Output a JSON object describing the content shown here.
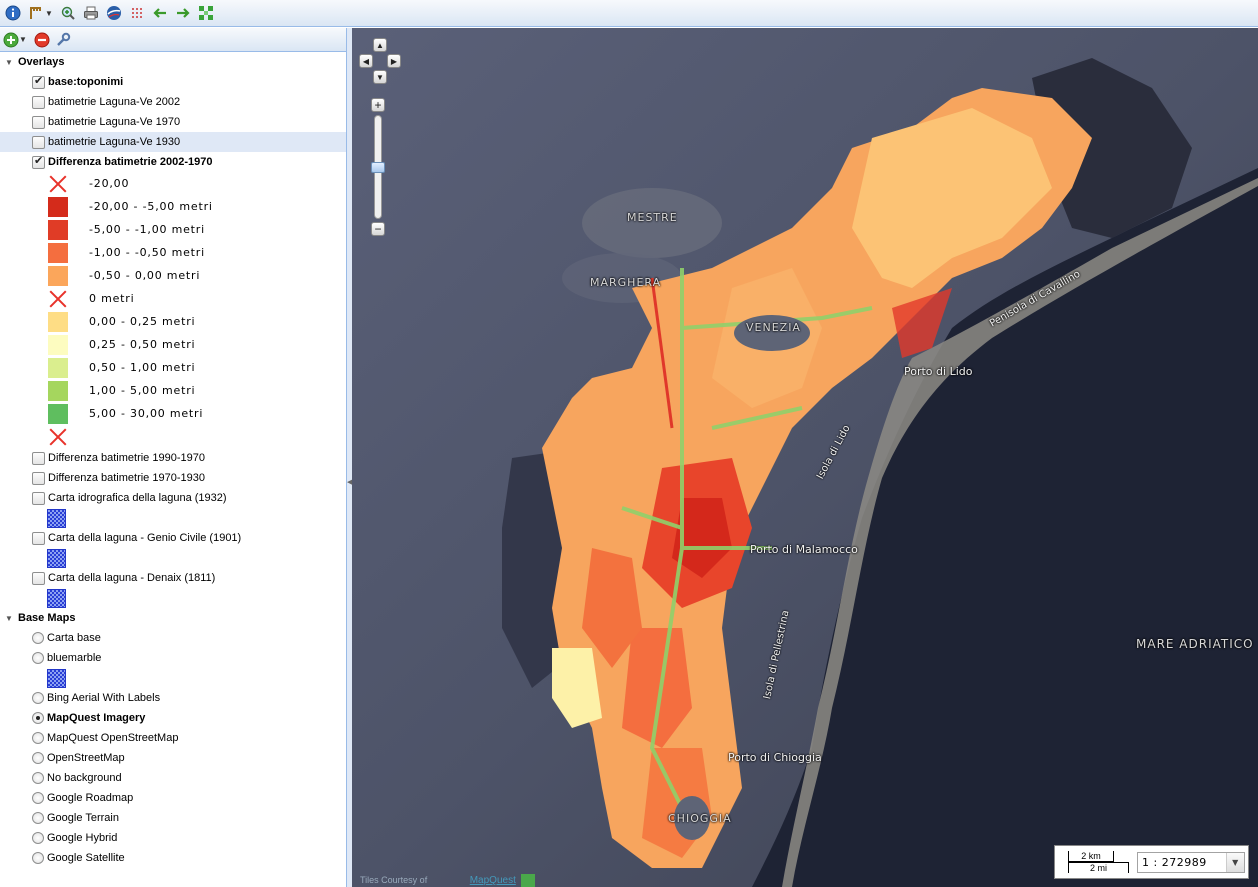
{
  "toolbar": {
    "buttons": [
      "info-icon",
      "measure-icon",
      "zoom-in-icon",
      "print-icon",
      "google-earth-icon",
      "measure-clear-icon",
      "back-arrow-icon",
      "forward-arrow-icon",
      "zoom-extent-icon"
    ]
  },
  "layer_panel": {
    "toolbar": [
      "add-layer-icon",
      "remove-layer-icon",
      "layer-properties-icon"
    ],
    "overlays": {
      "label": "Overlays",
      "expanded": true,
      "layers": [
        {
          "label": "base:toponimi",
          "checked": true,
          "bold": true
        },
        {
          "label": "batimetrie Laguna-Ve 2002",
          "checked": false
        },
        {
          "label": "batimetrie Laguna-Ve 1970",
          "checked": false
        },
        {
          "label": "batimetrie Laguna-Ve 1930",
          "checked": false,
          "selected": true
        },
        {
          "label": "Differenza batimetrie 2002-1970",
          "checked": true,
          "bold": true
        }
      ],
      "legend": [
        {
          "label": "-20,00",
          "color": "cross"
        },
        {
          "label": "-20,00 - -5,00 metri",
          "color": "#d42b1b"
        },
        {
          "label": "-5,00 - -1,00 metri",
          "color": "#e03c26"
        },
        {
          "label": "-1,00 - -0,50 metri",
          "color": "#f46e3f"
        },
        {
          "label": "-0,50 - 0,00 metri",
          "color": "#fba65b"
        },
        {
          "label": "0 metri",
          "color": "cross"
        },
        {
          "label": "0,00 - 0,25 metri",
          "color": "#fedd85"
        },
        {
          "label": "0,25 - 0,50 metri",
          "color": "#fdfcc0"
        },
        {
          "label": "0,50 - 1,00 metri",
          "color": "#daee8e"
        },
        {
          "label": "1,00 - 5,00 metri",
          "color": "#a5d65e"
        },
        {
          "label": "5,00 - 30,00 metri",
          "color": "#5fbe5f"
        },
        {
          "label": "",
          "color": "cross"
        }
      ],
      "more_layers": [
        {
          "label": "Differenza batimetrie 1990-1970",
          "checked": false,
          "pattern": false
        },
        {
          "label": "Differenza batimetrie 1970-1930",
          "checked": false,
          "pattern": false
        },
        {
          "label": "Carta idrografica della laguna (1932)",
          "checked": false,
          "pattern": true
        },
        {
          "label": "Carta della laguna - Genio Civile (1901)",
          "checked": false,
          "pattern": true
        },
        {
          "label": "Carta della laguna - Denaix (1811)",
          "checked": false,
          "pattern": true
        }
      ]
    },
    "base_maps": {
      "label": "Base Maps",
      "expanded": true,
      "layers": [
        {
          "label": "Carta base",
          "selected": false,
          "pattern": false
        },
        {
          "label": "bluemarble",
          "selected": false,
          "pattern": true
        },
        {
          "label": "Bing Aerial With Labels",
          "selected": false,
          "pattern": false
        },
        {
          "label": "MapQuest Imagery",
          "selected": true,
          "pattern": false
        },
        {
          "label": "MapQuest OpenStreetMap",
          "selected": false,
          "pattern": false
        },
        {
          "label": "OpenStreetMap",
          "selected": false,
          "pattern": false
        },
        {
          "label": "No background",
          "selected": false,
          "pattern": false
        },
        {
          "label": "Google Roadmap",
          "selected": false,
          "pattern": false
        },
        {
          "label": "Google Terrain",
          "selected": false,
          "pattern": false
        },
        {
          "label": "Google Hybrid",
          "selected": false,
          "pattern": false
        },
        {
          "label": "Google Satellite",
          "selected": false,
          "pattern": false
        }
      ]
    }
  },
  "map": {
    "labels": {
      "mestre": "MESTRE",
      "marghera": "MARGHERA",
      "venezia": "VENEZIA",
      "porto_lido": "Porto di Lido",
      "penisola_cavallino": "Penisola di Cavallino",
      "isola_lido": "Isola di Lido",
      "porto_malamocco": "Porto di Malamocco",
      "isola_pellestrina": "Isola di Pellestrina",
      "mare_adriatico": "MARE ADRIATICO",
      "porto_chioggia": "Porto di Chioggia",
      "chioggia": "CHIOGGIA"
    },
    "attribution": "Tiles Courtesy of",
    "attribution_link": "MapQuest",
    "scale_top": "2 km",
    "scale_bottom": "2 mi",
    "scale_value": "1 : 272989"
  }
}
